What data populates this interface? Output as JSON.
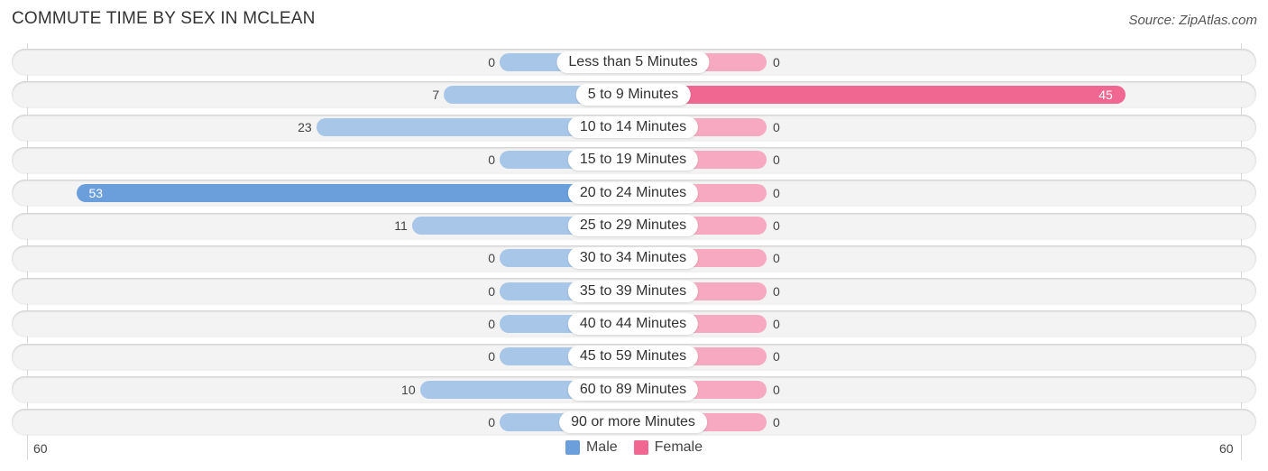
{
  "title": "COMMUTE TIME BY SEX IN MCLEAN",
  "source": "Source: ZipAtlas.com",
  "colors": {
    "male": "#6a9fdb",
    "male_light": "#a8c6e8",
    "female": "#f06792",
    "female_light": "#f6a9c0"
  },
  "chart_data": {
    "type": "bar",
    "orientation": "horizontal-diverging",
    "title": "COMMUTE TIME BY SEX IN MCLEAN",
    "categories": [
      "Less than 5 Minutes",
      "5 to 9 Minutes",
      "10 to 14 Minutes",
      "15 to 19 Minutes",
      "20 to 24 Minutes",
      "25 to 29 Minutes",
      "30 to 34 Minutes",
      "35 to 39 Minutes",
      "40 to 44 Minutes",
      "45 to 59 Minutes",
      "60 to 89 Minutes",
      "90 or more Minutes"
    ],
    "series": [
      {
        "name": "Male",
        "values": [
          0,
          7,
          23,
          0,
          53,
          11,
          0,
          0,
          0,
          0,
          10,
          0
        ]
      },
      {
        "name": "Female",
        "values": [
          0,
          45,
          0,
          0,
          0,
          0,
          0,
          0,
          0,
          0,
          0,
          0
        ]
      }
    ],
    "axis": {
      "left_label": "60",
      "right_label": "60",
      "range": [
        -60,
        60
      ]
    },
    "legend": {
      "position": "bottom-center",
      "entries": [
        "Male",
        "Female"
      ]
    },
    "grid": false
  }
}
